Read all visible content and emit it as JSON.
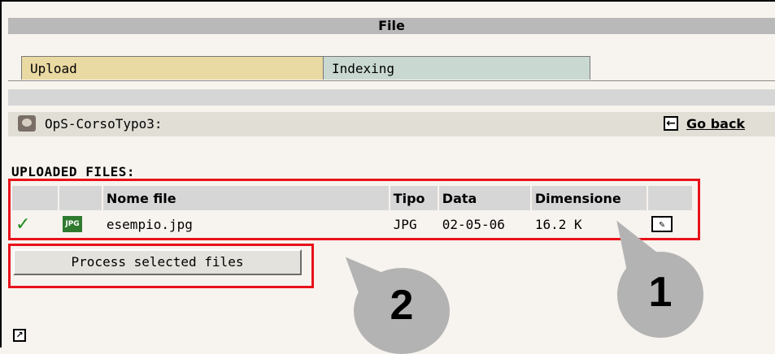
{
  "header": {
    "title": "File"
  },
  "tabs": [
    {
      "label": "Upload",
      "color": "#e9d9a2"
    },
    {
      "label": "Indexing",
      "color": "#c9d9d2"
    }
  ],
  "path": {
    "text": "OpS-CorsoTypo3:"
  },
  "navigation": {
    "go_back_label": "Go back"
  },
  "uploaded": {
    "section_title": "UPLOADED FILES:",
    "columns": [
      "",
      "",
      "Nome file",
      "Tipo",
      "Data",
      "Dimensione",
      ""
    ],
    "rows": [
      {
        "icon": "jpg-file-icon",
        "name": "esempio.jpg",
        "type": "JPG",
        "date": "02-05-06",
        "size": "16.2 K"
      }
    ]
  },
  "actions": {
    "process_label": "Process selected files"
  },
  "annotations": {
    "callout_1": "1",
    "callout_2": "2",
    "highlight_color": "#e8121a"
  }
}
